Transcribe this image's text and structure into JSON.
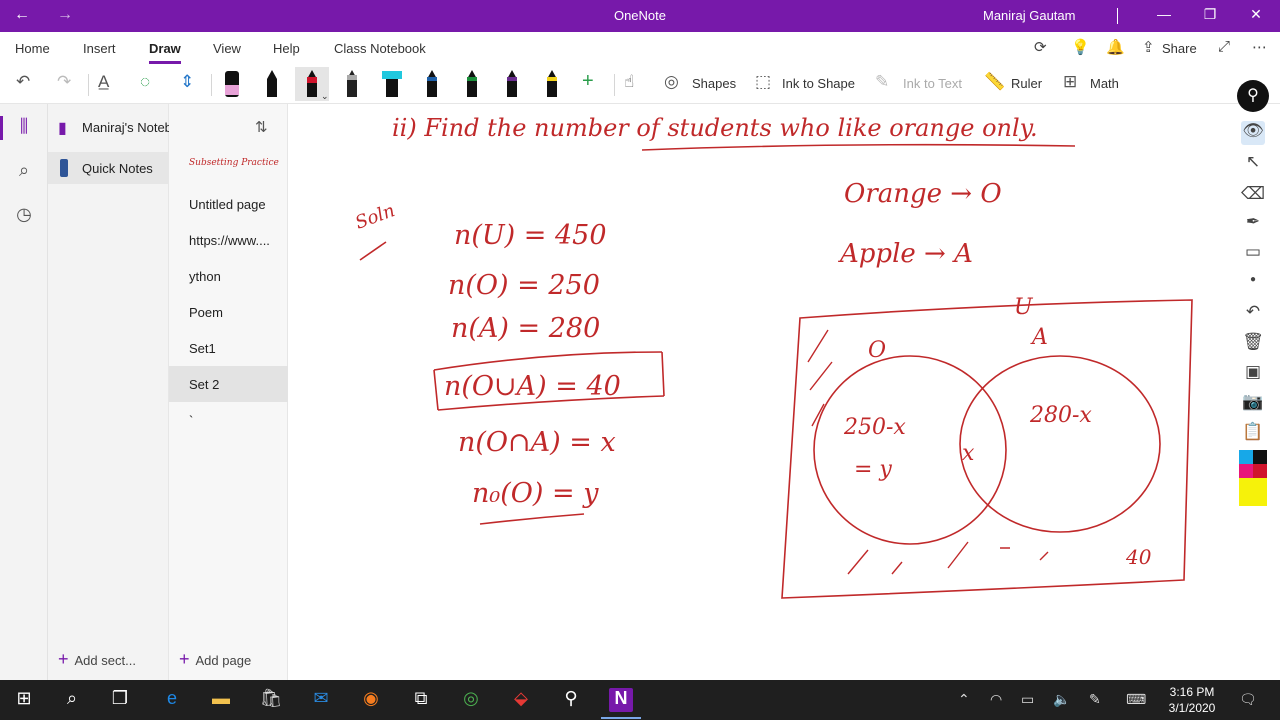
{
  "window": {
    "title": "OneNote",
    "user": "Maniraj Gautam",
    "back_icon": "←",
    "forward_icon": "→",
    "minimize_icon": "—",
    "restore_icon": "❐",
    "close_icon": "✕"
  },
  "ribbon": {
    "tabs": [
      "Home",
      "Insert",
      "Draw",
      "View",
      "Help",
      "Class Notebook"
    ],
    "active_tab": "Draw",
    "share_label": "Share"
  },
  "toolbar": {
    "shapes_label": "Shapes",
    "ink_to_shape_label": "Ink to Shape",
    "ink_to_text_label": "Ink to Text",
    "ruler_label": "Ruler",
    "math_label": "Math",
    "pen_colors": [
      "#e8a3d8",
      "#111111",
      "#d0142c",
      "#222222",
      "#21c8de",
      "#1d5fa8",
      "#1a8f3a",
      "#6a2c8f",
      "#f2d21a"
    ]
  },
  "notebook": {
    "name": "Maniraj's Notebook",
    "section": "Quick Notes",
    "add_section_label": "Add sect...",
    "add_page_label": "Add page",
    "pages": [
      "Subsetting Practice",
      "Untitled page",
      "https://www....",
      "ython",
      "Poem",
      "Set1",
      "Set 2",
      "`"
    ],
    "selected_page": "Set 2"
  },
  "ink": {
    "question": "ii) Find the number of students who like orange only.",
    "soln": "Soln",
    "equations": [
      "n(U) = 450",
      "n(O) = 250",
      "n(A) = 280",
      "n(O∪A) = 40",
      "n(O∩A) = x",
      "n₀(O) = y"
    ],
    "legend_orange": "Orange → O",
    "legend_apple": "Apple → A",
    "venn_universe": "U",
    "venn_set_o": "O",
    "venn_set_a": "A",
    "venn_o_only": "250-x",
    "venn_o_only_eq": "= y",
    "venn_intersection": "x",
    "venn_a_only": "280-x",
    "venn_outside": "40"
  },
  "taskbar": {
    "time": "3:16 PM",
    "date": "3/1/2020"
  }
}
